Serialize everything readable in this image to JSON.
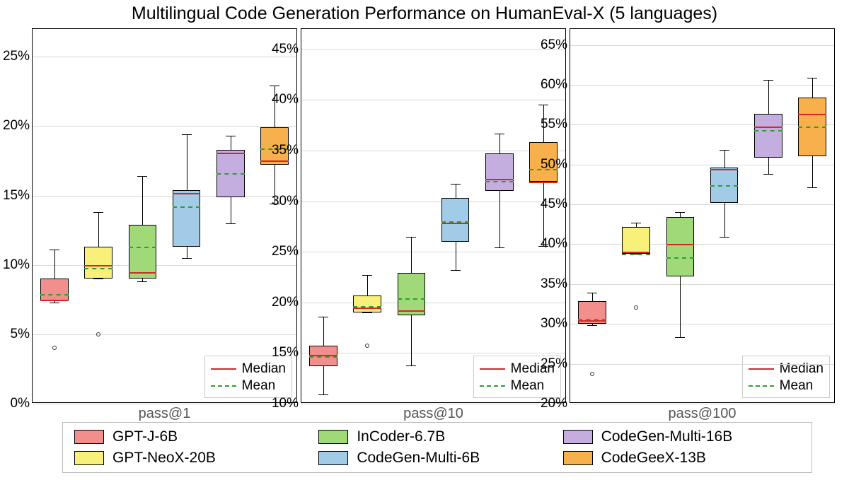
{
  "title": "Multilingual Code Generation Performance on HumanEval-X (5 languages)",
  "legend_inner": {
    "median": "Median",
    "mean": "Mean"
  },
  "models": [
    {
      "name": "GPT-J-6B",
      "color": "#f28e8c"
    },
    {
      "name": "GPT-NeoX-20B",
      "color": "#f9f07a"
    },
    {
      "name": "InCoder-6.7B",
      "color": "#a0d978"
    },
    {
      "name": "CodeGen-Multi-6B",
      "color": "#a2cbe8"
    },
    {
      "name": "CodeGen-Multi-16B",
      "color": "#c4aee0"
    },
    {
      "name": "CodeGeeX-13B",
      "color": "#f7b04c"
    }
  ],
  "chart_data": [
    {
      "type": "box",
      "xlabel": "pass@1",
      "ylim": [
        0,
        27
      ],
      "yticks": [
        0,
        5,
        10,
        15,
        20,
        25
      ],
      "ytick_labels": [
        "0%",
        "5%",
        "10%",
        "15%",
        "20%",
        "25%"
      ],
      "series": [
        {
          "name": "GPT-J-6B",
          "q1": 7.4,
          "median": 7.5,
          "q3": 9.0,
          "low": 7.3,
          "high": 11.1,
          "mean": 7.9,
          "outliers": [
            4.0
          ]
        },
        {
          "name": "GPT-NeoX-20B",
          "q1": 9.0,
          "median": 10.0,
          "q3": 11.3,
          "low": 9.0,
          "high": 13.8,
          "mean": 9.8,
          "outliers": [
            5.0
          ]
        },
        {
          "name": "InCoder-6.7B",
          "q1": 9.0,
          "median": 9.5,
          "q3": 12.9,
          "low": 8.8,
          "high": 16.4,
          "mean": 11.3,
          "outliers": []
        },
        {
          "name": "CodeGen-Multi-6B",
          "q1": 11.3,
          "median": 15.2,
          "q3": 15.4,
          "low": 10.5,
          "high": 19.4,
          "mean": 14.2,
          "outliers": []
        },
        {
          "name": "CodeGen-Multi-16B",
          "q1": 14.9,
          "median": 18.1,
          "q3": 18.3,
          "low": 13.0,
          "high": 19.3,
          "mean": 16.6,
          "outliers": []
        },
        {
          "name": "CodeGeeX-13B",
          "q1": 17.2,
          "median": 17.5,
          "q3": 19.9,
          "low": 14.4,
          "high": 22.9,
          "mean": 18.4,
          "outliers": []
        }
      ]
    },
    {
      "type": "box",
      "xlabel": "pass@10",
      "ylim": [
        10,
        47
      ],
      "yticks": [
        10,
        15,
        20,
        25,
        30,
        35,
        40,
        45
      ],
      "ytick_labels": [
        "10%",
        "15%",
        "20%",
        "25%",
        "30%",
        "35%",
        "40%",
        "45%"
      ],
      "series": [
        {
          "name": "GPT-J-6B",
          "q1": 13.7,
          "median": 14.8,
          "q3": 15.7,
          "low": 10.9,
          "high": 18.6,
          "mean": 14.7,
          "outliers": []
        },
        {
          "name": "GPT-NeoX-20B",
          "q1": 19.0,
          "median": 19.5,
          "q3": 20.7,
          "low": 19.0,
          "high": 22.7,
          "mean": 19.6,
          "outliers": [
            15.7
          ]
        },
        {
          "name": "InCoder-6.7B",
          "q1": 18.7,
          "median": 19.2,
          "q3": 22.9,
          "low": 13.8,
          "high": 26.5,
          "mean": 20.4,
          "outliers": []
        },
        {
          "name": "CodeGen-Multi-6B",
          "q1": 26.0,
          "median": 27.9,
          "q3": 30.3,
          "low": 23.2,
          "high": 31.7,
          "mean": 28.0,
          "outliers": []
        },
        {
          "name": "CodeGen-Multi-16B",
          "q1": 31.0,
          "median": 32.2,
          "q3": 34.7,
          "low": 25.4,
          "high": 36.7,
          "mean": 32.0,
          "outliers": []
        },
        {
          "name": "CodeGeeX-13B",
          "q1": 31.9,
          "median": 31.9,
          "q3": 35.8,
          "low": 25.6,
          "high": 39.5,
          "mean": 33.2,
          "outliers": []
        }
      ]
    },
    {
      "type": "box",
      "xlabel": "pass@100",
      "ylim": [
        20,
        67
      ],
      "yticks": [
        20,
        25,
        30,
        35,
        40,
        45,
        50,
        55,
        60,
        65
      ],
      "ytick_labels": [
        "20%",
        "25%",
        "30%",
        "35%",
        "40%",
        "45%",
        "50%",
        "55%",
        "60%",
        "65%"
      ],
      "series": [
        {
          "name": "GPT-J-6B",
          "q1": 30.0,
          "median": 30.5,
          "q3": 32.9,
          "low": 29.8,
          "high": 33.9,
          "mean": 30.6,
          "outliers": [
            23.7
          ]
        },
        {
          "name": "GPT-NeoX-20B",
          "q1": 38.8,
          "median": 39.1,
          "q3": 42.2,
          "low": 38.8,
          "high": 42.7,
          "mean": 38.8,
          "outliers": [
            32.1
          ]
        },
        {
          "name": "InCoder-6.7B",
          "q1": 36.0,
          "median": 40.0,
          "q3": 43.4,
          "low": 28.3,
          "high": 44.0,
          "mean": 38.4,
          "outliers": []
        },
        {
          "name": "CodeGen-Multi-6B",
          "q1": 45.2,
          "median": 49.4,
          "q3": 49.6,
          "low": 40.9,
          "high": 51.8,
          "mean": 47.4,
          "outliers": []
        },
        {
          "name": "CodeGen-Multi-16B",
          "q1": 50.9,
          "median": 54.8,
          "q3": 56.4,
          "low": 48.8,
          "high": 60.6,
          "mean": 54.3,
          "outliers": []
        },
        {
          "name": "CodeGeeX-13B",
          "q1": 51.0,
          "median": 56.4,
          "q3": 58.4,
          "low": 47.1,
          "high": 60.9,
          "mean": 54.8,
          "outliers": []
        }
      ]
    }
  ]
}
